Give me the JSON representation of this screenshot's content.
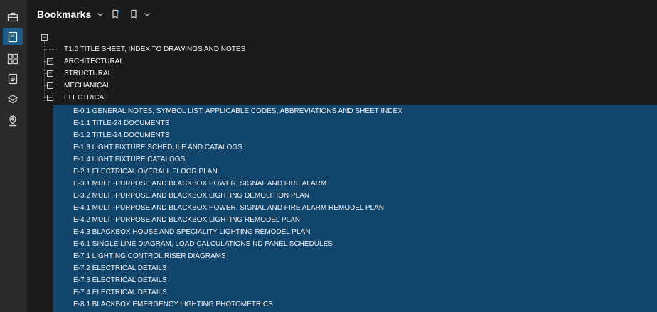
{
  "header": {
    "title": "Bookmarks"
  },
  "rail": [
    "briefcase-icon",
    "bookmark-panel-icon",
    "grid-icon",
    "document-icon",
    "layers-icon",
    "location-icon"
  ],
  "tree": {
    "root_toggle": "−",
    "top_item": "T1.0 TITLE SHEET, INDEX TO DRAWINGS AND NOTES",
    "groups": [
      {
        "label": "ARCHITECTURAL",
        "toggle": "+"
      },
      {
        "label": "STRUCTURAL",
        "toggle": "+"
      },
      {
        "label": "MECHANICAL",
        "toggle": "+"
      },
      {
        "label": "ELECTRICAL",
        "toggle": "−"
      }
    ],
    "electrical_children": [
      "E-0.1 GENERAL NOTES, SYMBOL LIST, APPLICABLE CODES, ABBREVIATIONS AND SHEET INDEX",
      "E-1.1 TITLE-24 DOCUMENTS",
      "E-1.2 TITLE-24 DOCUMENTS",
      "E-1.3 LIGHT FIXTURE SCHEDULE AND CATALOGS",
      "E-1.4 LIGHT FIXTURE CATALOGS",
      "E-2.1 ELECTRICAL OVERALL FLOOR PLAN",
      "E-3.1 MULTI-PURPOSE AND BLACKBOX POWER, SIGNAL AND FIRE ALARM",
      "E-3.2 MULTI-PURPOSE AND BLACKBOX LIGHTING DEMOLITION PLAN",
      "E-4.1 MULTI-PURPOSE AND BLACKBOX POWER, SIGNAL AND FIRE ALARM REMODEL PLAN",
      "E-4.2 MULTI-PURPOSE AND BLACKBOX LIGHTING REMODEL PLAN",
      "E-4.3 BLACKBOX HOUSE AND SPECIALITY LIGHTING REMODEL PLAN",
      "E-6.1 SINGLE LINE DIAGRAM, LOAD CALCULATIONS ND  PANEL SCHEDULES",
      "E-7.1 LIGHTING CONTROL RISER DIAGRAMS",
      "E-7.2 ELECTRICAL DETAILS",
      "E-7.3 ELECTRICAL DETAILS",
      "E-7.4 ELECTRICAL DETAILS",
      "E-8.1 BLACKBOX EMERGENCY LIGHTING PHOTOMETRICS"
    ]
  },
  "colors": {
    "selection": "#12456c",
    "accent": "#1a5c8a",
    "panel_bg": "#1b1b1b"
  }
}
